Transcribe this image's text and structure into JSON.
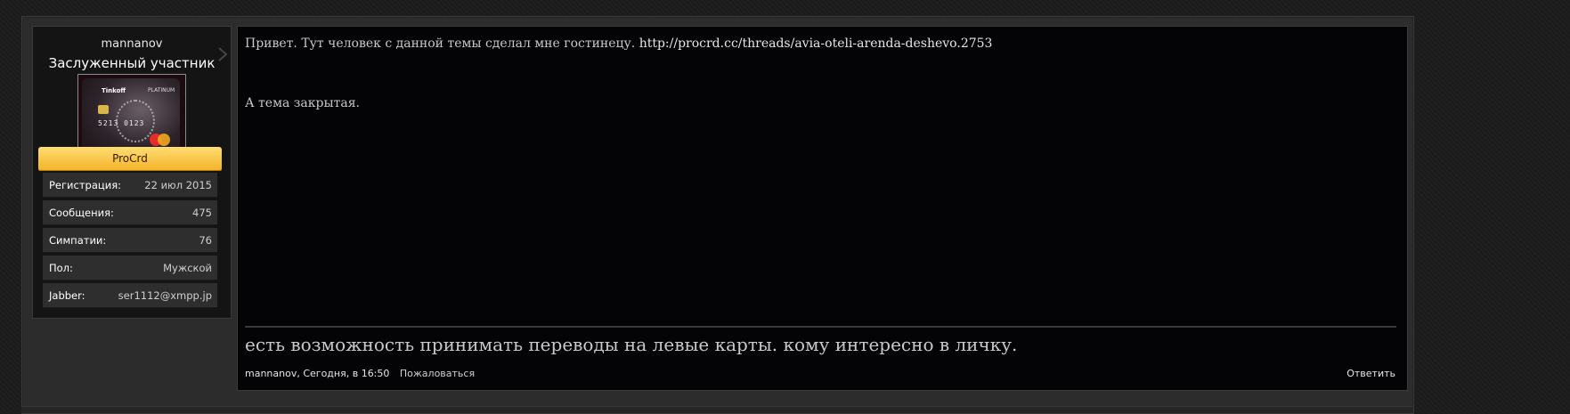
{
  "user": {
    "name": "mannanov",
    "title": "Заслуженный участник",
    "avatar_text": {
      "brand": "Tinkoff",
      "tier": "PLATINUM",
      "number": "5213 0123"
    },
    "ribbon": "ProCrd",
    "stats": [
      {
        "label": "Регистрация:",
        "value": "22 июл 2015"
      },
      {
        "label": "Сообщения:",
        "value": "475"
      },
      {
        "label": "Симпатии:",
        "value": "76"
      },
      {
        "label": "Пол:",
        "value": "Мужской"
      },
      {
        "label": "Jabber:",
        "value": "ser1112@xmpp.jp"
      }
    ]
  },
  "post": {
    "text_before_link": "Привет. Тут человек с данной темы сделал мне гостинецу.",
    "link": "http://procrd.cc/threads/avia-oteli-arenda-deshevo.2753",
    "text2": "А тема закрытая.",
    "signature": "есть возможность принимать переводы на левые карты. кому интересно в личку.",
    "meta": {
      "author_time": "mannanov, Сегодня, в 16:50",
      "report": "Пожаловаться",
      "reply": "Ответить"
    }
  },
  "colors": {
    "background": "#1b1b1b",
    "message_bg": "#040406",
    "ribbon": "#f4b42a",
    "stat_row": "#2e2e2e"
  }
}
